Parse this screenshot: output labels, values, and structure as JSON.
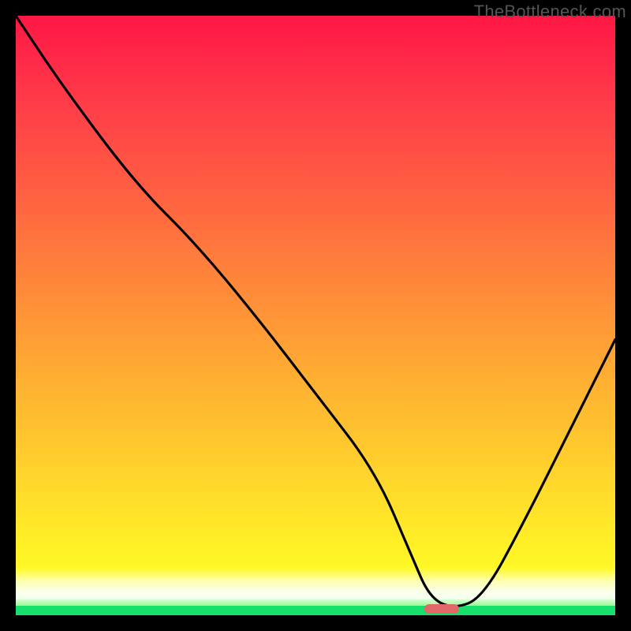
{
  "watermark": "TheBottleneck.com",
  "chart_data": {
    "type": "line",
    "title": "",
    "xlabel": "",
    "ylabel": "",
    "ylim": [
      0,
      100
    ],
    "xlim": [
      0,
      100
    ],
    "series": [
      {
        "name": "bottleneck-curve",
        "x": [
          0,
          8,
          20,
          30,
          40,
          50,
          60,
          66,
          69,
          73,
          78,
          85,
          92,
          100
        ],
        "values": [
          100,
          88,
          72,
          62,
          50,
          37,
          24,
          10,
          3,
          1,
          3,
          16,
          30,
          46
        ]
      }
    ],
    "optimum_x": 71,
    "marker_color": "#e06868",
    "gradient_stops": [
      {
        "pos": 0,
        "color": "#ff1744"
      },
      {
        "pos": 50,
        "color": "#ff9637"
      },
      {
        "pos": 90,
        "color": "#fff226"
      },
      {
        "pos": 97,
        "color": "#fbffe6"
      },
      {
        "pos": 100,
        "color": "#16e06a"
      }
    ]
  }
}
